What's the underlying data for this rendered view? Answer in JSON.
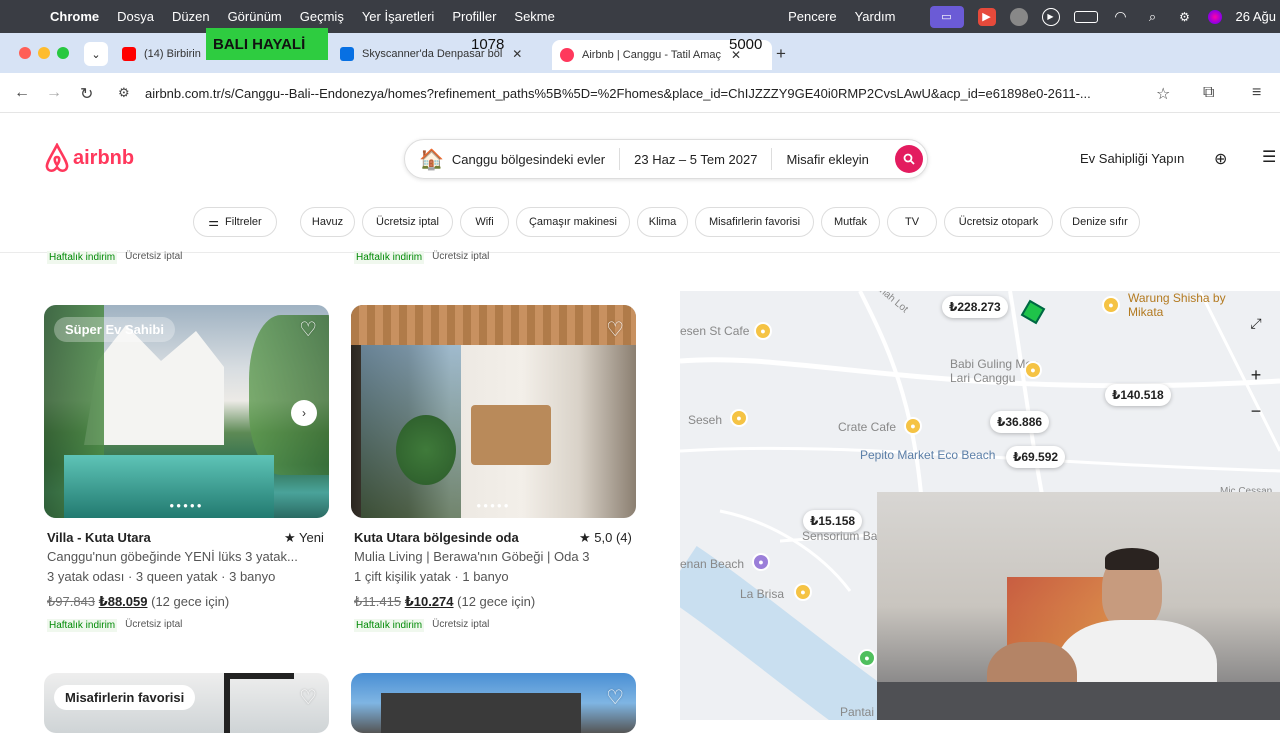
{
  "menubar": {
    "app": "Chrome",
    "items": [
      "Dosya",
      "Düzen",
      "Görünüm",
      "Geçmiş",
      "Yer İşaretleri",
      "Profiller",
      "Sekme"
    ],
    "right_items": [
      "Pencere",
      "Yardım"
    ],
    "date": "26 Ağu"
  },
  "overlays": {
    "title": "BALI HAYALİ",
    "num1": "1078",
    "num2": "5000"
  },
  "tabs": [
    {
      "label": "(14) Birbirin",
      "favicon_color": "#ff0000"
    },
    {
      "label": "Skyscanner'da Denpasar böl",
      "favicon_color": "#0770e3"
    },
    {
      "label": "Airbnb | Canggu - Tatil Amaç",
      "favicon_color": "#ff385c"
    }
  ],
  "address": {
    "url": "airbnb.com.tr/s/Canggu--Bali--Endonezya/homes?refinement_paths%5B%5D=%2Fhomes&place_id=ChIJZZZY9GE40i0RMP2CvsLAwU&acp_id=e61898e0-2611-..."
  },
  "header": {
    "logo_text": "airbnb",
    "search_location": "Canggu bölgesindeki evler",
    "search_dates": "23 Haz – 5 Tem 2027",
    "search_guests": "Misafir ekleyin",
    "host_link": "Ev Sahipliği Yapın"
  },
  "filters": {
    "main": "Filtreler",
    "chips": [
      "Havuz",
      "Ücretsiz iptal",
      "Wifi",
      "Çamaşır makinesi",
      "Klima",
      "Misafirlerin favorisi",
      "Mutfak",
      "TV",
      "Ücretsiz otopark",
      "Denize sıfır"
    ]
  },
  "top_tags": {
    "weekly": "Haftalık indirim",
    "free_cancel": "Ücretsiz iptal"
  },
  "listings": [
    {
      "badge": "Süper Ev Sahibi",
      "title": "Villa - Kuta Utara",
      "rating": "★ Yeni",
      "desc": "Canggu'nun göbeğinde YENİ lüks 3 yatak...",
      "details": "3 yatak odası · 3 queen yatak · 3 banyo",
      "old_price": "₺97.843",
      "new_price": "₺88.059",
      "per": "(12 gece için)",
      "tag1": "Haftalık indirim",
      "tag2": "Ücretsiz iptal"
    },
    {
      "badge": "",
      "title": "Kuta Utara bölgesinde oda",
      "rating": "★ 5,0 (4)",
      "desc": "Mulia Living | Berawa'nın Göbeği | Oda 3",
      "details": "1 çift kişilik yatak · 1 banyo",
      "old_price": "₺11.415",
      "new_price": "₺10.274",
      "per": "(12 gece için)",
      "tag1": "Haftalık indirim",
      "tag2": "Ücretsiz iptal"
    }
  ],
  "next_row": {
    "badge": "Misafirlerin favorisi"
  },
  "map": {
    "prices": [
      "₺228.273",
      "₺140.518",
      "₺36.886",
      "₺69.592",
      "₺15.158"
    ],
    "pois": {
      "warung": "Warung Shisha by Mikata",
      "sst": "esen St Cafe",
      "babi": "Babi Guling Men Lari Canggu",
      "seseh": "Seseh",
      "crate": "Crate Cafe",
      "pepito": "Pepito Market Eco Beach",
      "sensorium": "Sensorium Bali",
      "enan": "enan Beach",
      "labrisa": "La Brisa",
      "pantai": "Pantai",
      "mic": "Mic Cessan Cem",
      "road": "anah Lot"
    }
  }
}
